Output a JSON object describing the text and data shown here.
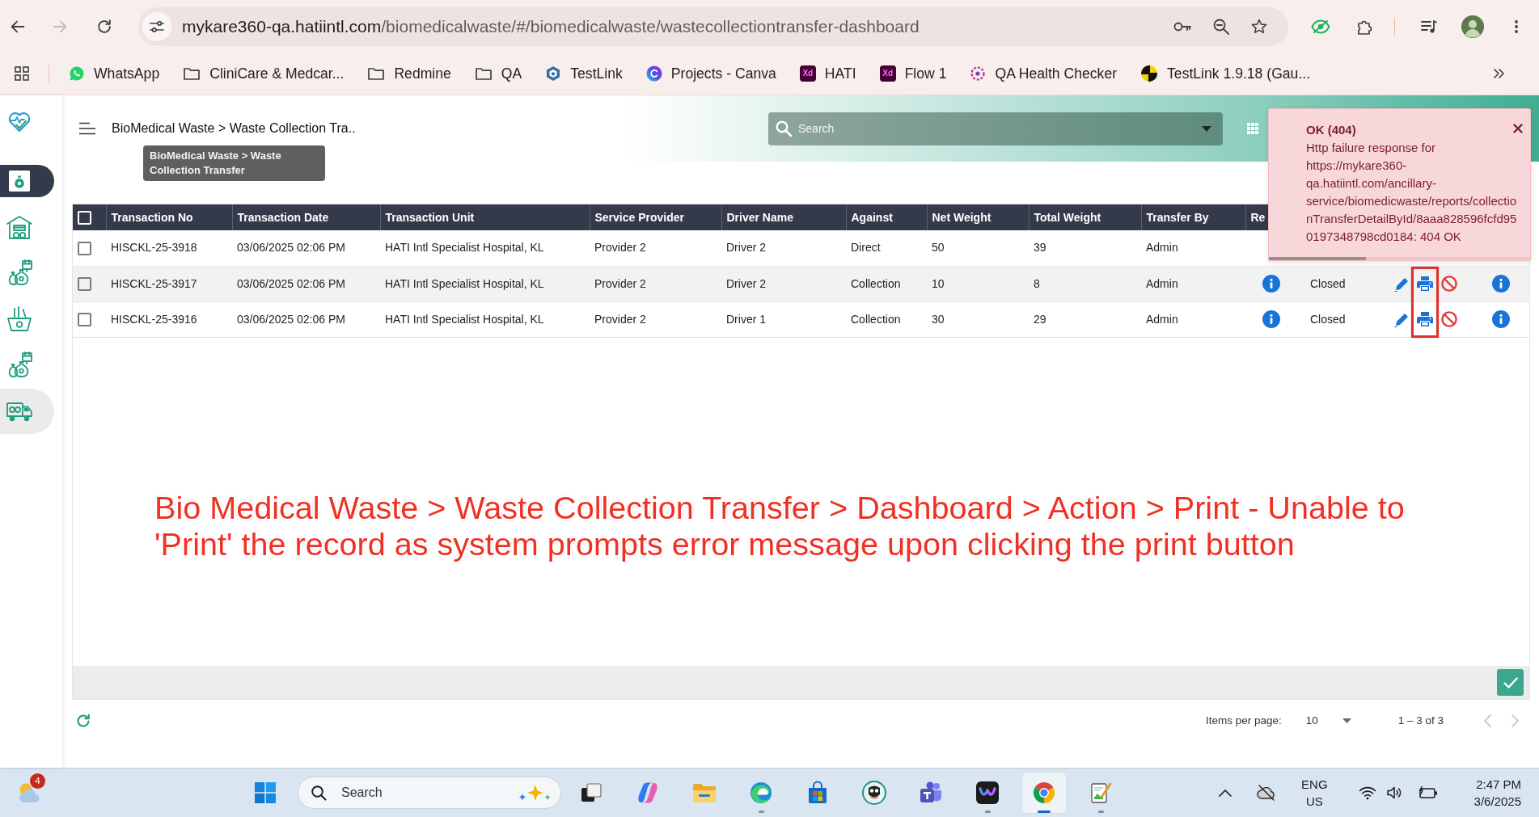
{
  "browser": {
    "nav": {
      "back_disabled": false,
      "forward_disabled": true
    },
    "address_bar": {
      "host": "mykare360-qa.hatiintl.com",
      "path": "/biomedicalwaste/#/biomedicalwaste/wastecollectiontransfer-dashboard"
    },
    "bookmarks": [
      {
        "label": "WhatsApp",
        "kind": "chat"
      },
      {
        "label": "CliniCare & Medcar...",
        "kind": "folder"
      },
      {
        "label": "Redmine",
        "kind": "folder"
      },
      {
        "label": "QA",
        "kind": "folder"
      },
      {
        "label": "TestLink",
        "kind": "hexagon"
      },
      {
        "label": "Projects - Canva",
        "kind": "gradient-circle"
      },
      {
        "label": "HATI",
        "kind": "tile",
        "tile_text": "Xd"
      },
      {
        "label": "Flow 1",
        "kind": "tile",
        "tile_text": "Xd"
      },
      {
        "label": "QA Health Checker",
        "kind": "dotted-ring"
      },
      {
        "label": "TestLink 1.9.18 (Gau...",
        "kind": "quartered-circle"
      }
    ]
  },
  "sidebar": {
    "items": [
      {
        "kind": "waste-bag",
        "selected": true,
        "highlighted": false
      },
      {
        "kind": "warehouse",
        "selected": false,
        "highlighted": false
      },
      {
        "kind": "bags-calendar",
        "selected": false,
        "highlighted": false
      },
      {
        "kind": "basket",
        "selected": false,
        "highlighted": false
      },
      {
        "kind": "bags-calendar",
        "selected": false,
        "highlighted": false
      },
      {
        "kind": "truck",
        "selected": false,
        "highlighted": true
      }
    ]
  },
  "header": {
    "breadcrumb": "BioMedical Waste > Waste Collection Tra..",
    "tooltip": "BioMedical Waste > Waste Collection Transfer",
    "search": {
      "placeholder": "Search"
    }
  },
  "toast": {
    "title": "OK (404)",
    "message": "Http failure response for https://mykare360-qa.hatiintl.com/ancillary-service/biomedicwaste/reports/collectionTransferDetailById/8aaa828596fcfd950197348798cd0184: 404 OK",
    "progress": {
      "level": 0.37
    }
  },
  "table": {
    "select_all": {
      "checked": false
    },
    "columns": [
      "Transaction No",
      "Transaction Date",
      "Transaction Unit",
      "Service Provider",
      "Driver Name",
      "Against",
      "Net Weight",
      "Total Weight",
      "Transfer By",
      "Re"
    ],
    "rows": [
      {
        "checked": false,
        "cells": [
          "HISCKL-25-3918",
          "03/06/2025 02:06 PM",
          "HATI Intl Specialist Hospital, KL",
          "Provider 2",
          "Driver 2",
          "Direct",
          "50",
          "39",
          "Admin"
        ]
      },
      {
        "checked": false,
        "cells": [
          "HISCKL-25-3917",
          "03/06/2025 02:06 PM",
          "HATI Intl Specialist Hospital, KL",
          "Provider 2",
          "Driver 2",
          "Collection",
          "10",
          "8",
          "Admin"
        ],
        "status": "Closed"
      },
      {
        "checked": false,
        "cells": [
          "HISCKL-25-3916",
          "03/06/2025 02:06 PM",
          "HATI Intl Specialist Hospital, KL",
          "Provider 2",
          "Driver 1",
          "Collection",
          "30",
          "29",
          "Admin"
        ],
        "status": "Closed"
      }
    ]
  },
  "annotation": {
    "text": "Bio Medical Waste > Waste Collection Transfer > Dashboard > Action > Print - Unable to 'Print' the record as system prompts error message upon clicking the print button"
  },
  "pagination": {
    "label": "Items per page:",
    "page_size": "10",
    "range": "1 – 3 of 3",
    "prev_disabled": true,
    "next_disabled": true
  },
  "taskbar": {
    "weather_badge": "4",
    "search": {
      "placeholder": "Search"
    },
    "apps": [
      {
        "kind": "task-view",
        "running": false,
        "selected": false
      },
      {
        "kind": "ribbon",
        "running": false,
        "selected": false
      },
      {
        "kind": "folder",
        "running": false,
        "selected": false
      },
      {
        "kind": "swirl",
        "running": true,
        "selected": false
      },
      {
        "kind": "bag",
        "running": false,
        "selected": false
      },
      {
        "kind": "mascot",
        "running": false,
        "selected": false
      },
      {
        "kind": "people",
        "running": false,
        "selected": false
      },
      {
        "kind": "wave",
        "running": true,
        "selected": false
      },
      {
        "kind": "tricolor",
        "running": true,
        "selected": true
      },
      {
        "kind": "notepad",
        "running": true,
        "selected": false
      }
    ],
    "tray": {
      "language": "ENG",
      "region": "US",
      "time": "2:47 PM",
      "date": "3/6/2025"
    }
  }
}
